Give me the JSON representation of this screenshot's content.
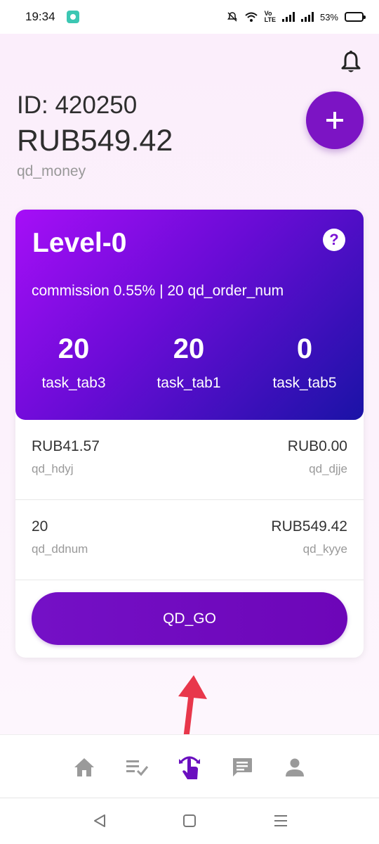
{
  "status_bar": {
    "time": "19:34",
    "battery": "53%"
  },
  "header": {
    "user_id": "ID: 420250",
    "balance": "RUB549.42",
    "balance_label": "qd_money"
  },
  "level_card": {
    "title": "Level-0",
    "info": "commission 0.55% | 20 qd_order_num",
    "stats": [
      {
        "value": "20",
        "label": "task_tab3"
      },
      {
        "value": "20",
        "label": "task_tab1"
      },
      {
        "value": "0",
        "label": "task_tab5"
      }
    ]
  },
  "rows": [
    {
      "left_value": "RUB41.57",
      "left_label": "qd_hdyj",
      "right_value": "RUB0.00",
      "right_label": "qd_djje"
    },
    {
      "left_value": "20",
      "left_label": "qd_ddnum",
      "right_value": "RUB549.42",
      "right_label": "qd_kyye"
    }
  ],
  "go_button": "QD_GO",
  "bottom_nav": [
    "home-icon",
    "task-list-icon",
    "grab-order-icon",
    "message-icon",
    "profile-icon"
  ],
  "colors": {
    "accent": "#7410c6",
    "card_gradient_start": "#a60ef7",
    "card_gradient_end": "#1a13a6",
    "arrow": "#e8374b"
  }
}
